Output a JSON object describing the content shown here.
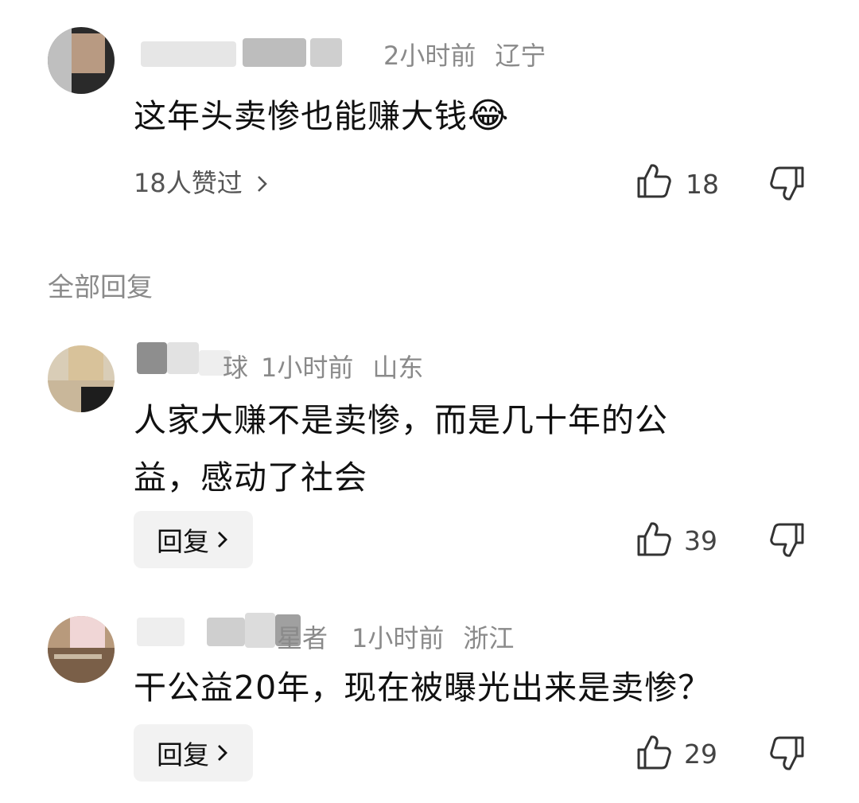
{
  "main_comment": {
    "time": "2小时前",
    "location": "辽宁",
    "text": "这年头卖惨也能赚大钱",
    "emoji": "😂",
    "likers_text": "18人赞过",
    "like_count": "18"
  },
  "replies_header": "全部回复",
  "replies": [
    {
      "name_visible": "球",
      "time": "1小时前",
      "location": "山东",
      "text_line1": "人家大赚不是卖惨，而是几十年的公",
      "text_line2": "益，感动了社会",
      "reply_label": "回复",
      "like_count": "39"
    },
    {
      "name_visible": "星者",
      "time": "1小时前",
      "location": "浙江",
      "text_line1": "干公益20年，现在被曝光出来是卖惨？",
      "reply_label": "回复",
      "like_count": "29"
    }
  ],
  "icons": {
    "like": "thumbs-up-icon",
    "dislike": "thumbs-down-icon",
    "chevron": "chevron-right-icon"
  }
}
